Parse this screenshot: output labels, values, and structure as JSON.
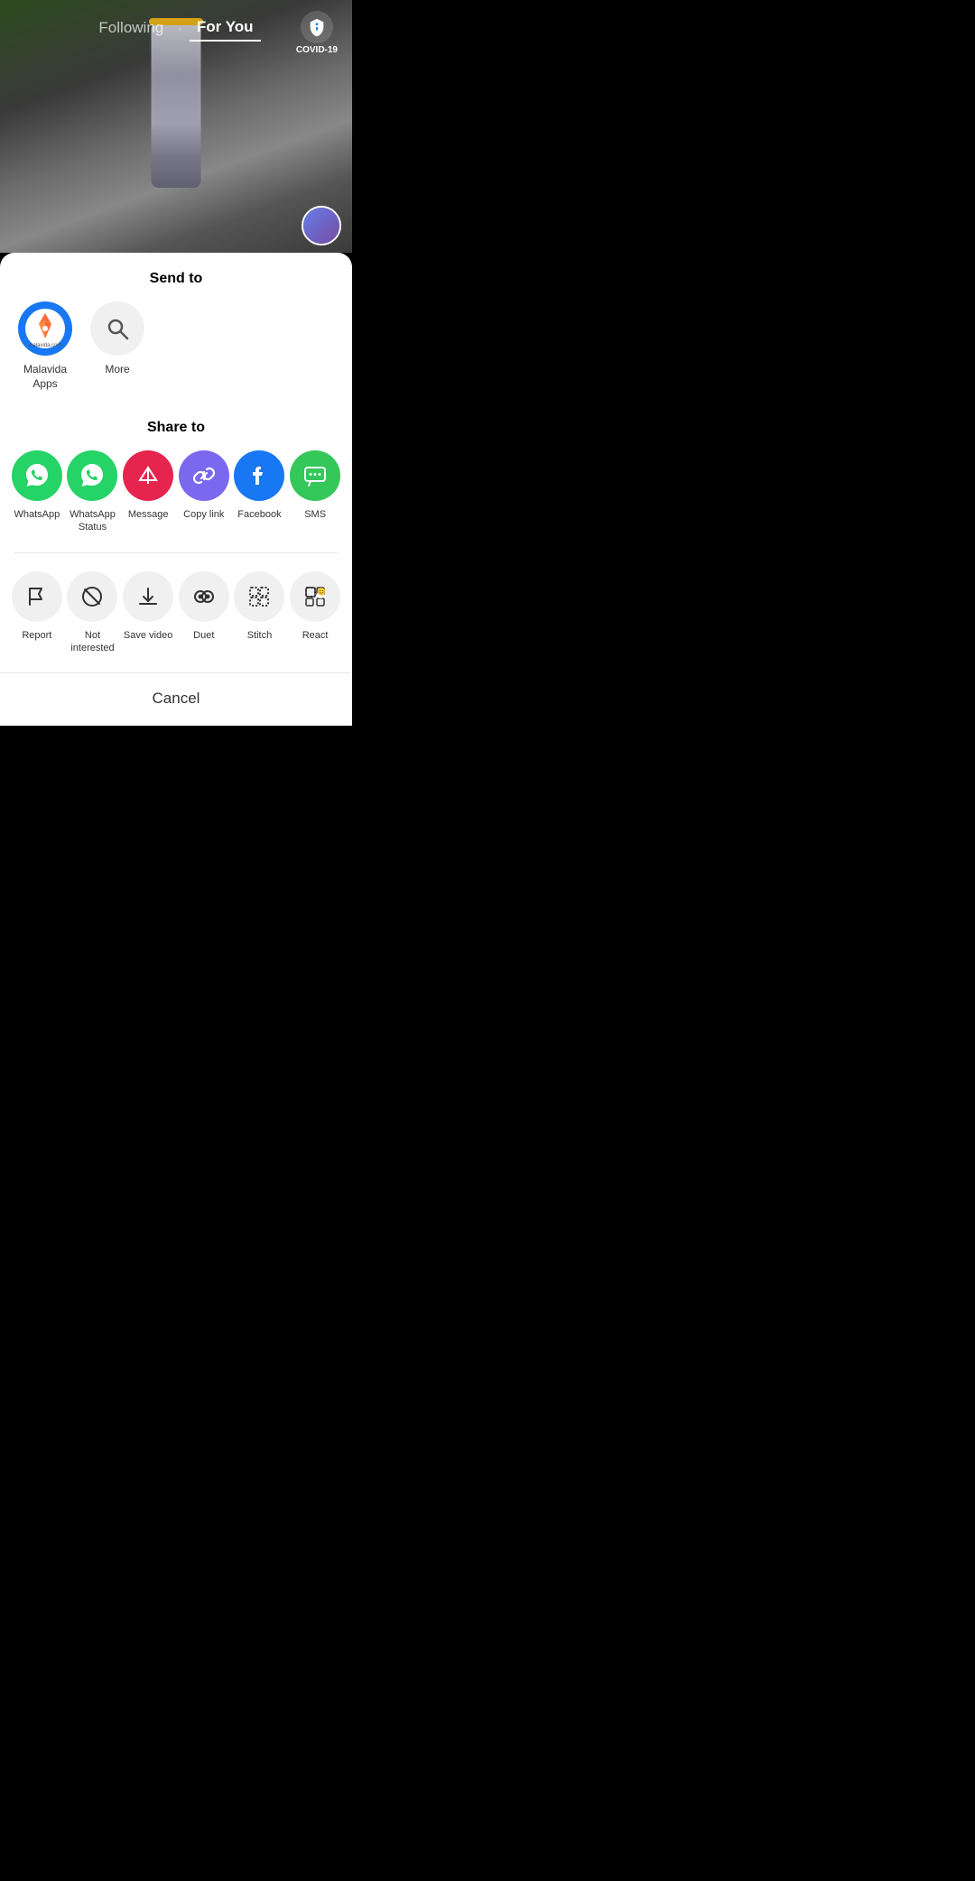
{
  "nav": {
    "following_label": "Following",
    "for_you_label": "For You",
    "covid_label": "COVID-19",
    "active_tab": "for_you"
  },
  "send_to": {
    "header": "Send to",
    "direct_items": [
      {
        "id": "malavida",
        "label": "Malavida\nApps",
        "type": "malavida"
      },
      {
        "id": "more",
        "label": "More",
        "type": "search"
      }
    ]
  },
  "share_to": {
    "header": "Share to",
    "items": [
      {
        "id": "whatsapp",
        "label": "WhatsApp",
        "color": "whatsapp-green"
      },
      {
        "id": "whatsapp-status",
        "label": "WhatsApp Status",
        "color": "whatsapp-status-green"
      },
      {
        "id": "message",
        "label": "Message",
        "color": "message-red"
      },
      {
        "id": "copy-link",
        "label": "Copy link",
        "color": "copy-purple"
      },
      {
        "id": "facebook",
        "label": "Facebook",
        "color": "facebook-blue"
      },
      {
        "id": "sms",
        "label": "SMS",
        "color": "sms-green"
      }
    ]
  },
  "actions": {
    "items": [
      {
        "id": "report",
        "label": "Report"
      },
      {
        "id": "not-interested",
        "label": "Not\ninterested"
      },
      {
        "id": "save-video",
        "label": "Save video"
      },
      {
        "id": "duet",
        "label": "Duet"
      },
      {
        "id": "stitch",
        "label": "Stitch"
      },
      {
        "id": "react",
        "label": "React"
      }
    ]
  },
  "cancel": {
    "label": "Cancel"
  }
}
